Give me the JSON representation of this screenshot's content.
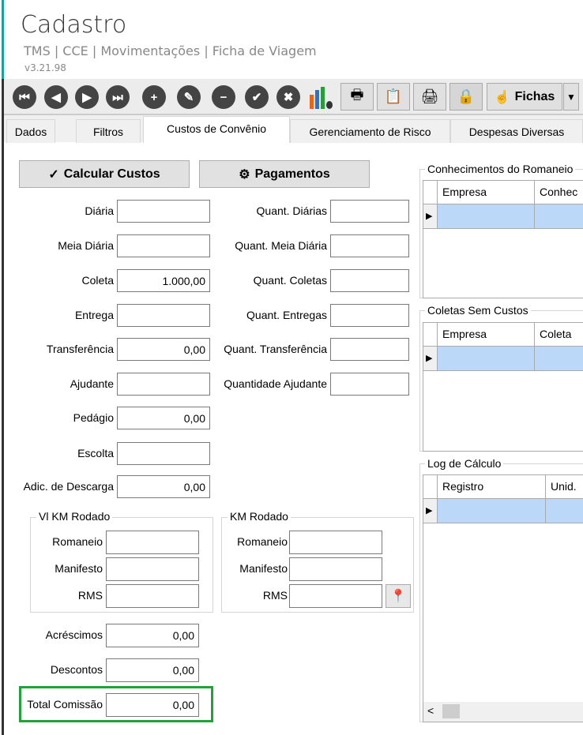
{
  "header": {
    "title": "Cadastro",
    "breadcrumb": "TMS | CCE | Movimentações | Ficha de Viagem",
    "version": "v3.21.98"
  },
  "toolbar": {
    "icons": [
      "first-icon",
      "previous-icon",
      "next-icon",
      "last-icon",
      "add-icon",
      "edit-icon",
      "remove-icon",
      "confirm-icon",
      "cancel-icon",
      "chart-settings-icon",
      "print-icon",
      "report-icon",
      "printer-icon",
      "lock-icon"
    ],
    "fichas_label": "Fichas"
  },
  "tabs": [
    {
      "label": "Dados"
    },
    {
      "label": "Filtros"
    },
    {
      "label": "Custos de Convênio",
      "active": true
    },
    {
      "label": "Gerenciamento de Risco"
    },
    {
      "label": "Despesas Diversas"
    }
  ],
  "actions": {
    "calcular": "Calcular Custos",
    "pagamentos": "Pagamentos"
  },
  "fields_left": [
    {
      "label": "Diária",
      "value": ""
    },
    {
      "label": "Meia Diária",
      "value": ""
    },
    {
      "label": "Coleta",
      "value": "1.000,00"
    },
    {
      "label": "Entrega",
      "value": ""
    },
    {
      "label": "Transferência",
      "value": "0,00"
    },
    {
      "label": "Ajudante",
      "value": ""
    },
    {
      "label": "Pedágio",
      "value": "0,00"
    },
    {
      "label": "Escolta",
      "value": ""
    },
    {
      "label": "Adic. de Descarga",
      "value": "0,00"
    }
  ],
  "fields_right": [
    {
      "label": "Quant. Diárias",
      "value": ""
    },
    {
      "label": "Quant. Meia Diária",
      "value": ""
    },
    {
      "label": "Quant. Coletas",
      "value": ""
    },
    {
      "label": "Quant. Entregas",
      "value": ""
    },
    {
      "label": "Quant. Transferência",
      "value": ""
    },
    {
      "label": "Quantidade Ajudante",
      "value": ""
    }
  ],
  "vl_km": {
    "title": "Vl KM Rodado",
    "fields": [
      {
        "label": "Romaneio",
        "value": ""
      },
      {
        "label": "Manifesto",
        "value": ""
      },
      {
        "label": "RMS",
        "value": ""
      }
    ]
  },
  "km": {
    "title": "KM Rodado",
    "fields": [
      {
        "label": "Romaneio",
        "value": ""
      },
      {
        "label": "Manifesto",
        "value": ""
      },
      {
        "label": "RMS",
        "value": ""
      }
    ]
  },
  "totals": [
    {
      "label": "Acréscimos",
      "value": "0,00"
    },
    {
      "label": "Descontos",
      "value": "0,00"
    },
    {
      "label": "Total Comissão",
      "value": "0,00"
    }
  ],
  "highlight_color": "#22a33a",
  "grids": [
    {
      "title": "Conhecimentos do Romaneio",
      "columns": [
        "Empresa",
        "Conhec"
      ]
    },
    {
      "title": "Coletas Sem Custos",
      "columns": [
        "Empresa",
        "Coleta"
      ]
    },
    {
      "title": "Log de Cálculo",
      "columns": [
        "Registro",
        "Unid."
      ]
    }
  ]
}
